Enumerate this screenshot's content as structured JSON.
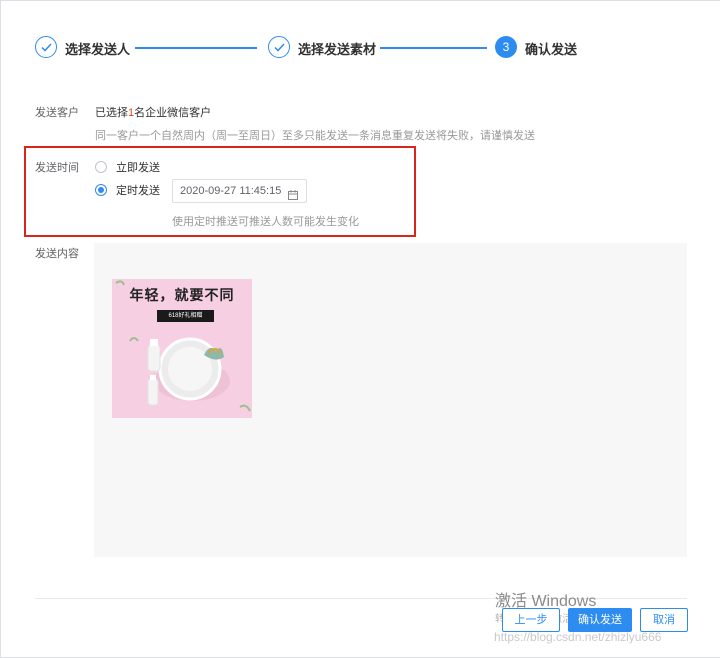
{
  "steps": [
    {
      "title": "选择发送人",
      "status": "done"
    },
    {
      "title": "选择发送素材",
      "status": "done"
    },
    {
      "title": "确认发送",
      "status": "active",
      "number": "3"
    }
  ],
  "recipients": {
    "label": "发送客户",
    "value_prefix": "已选择",
    "count": "1",
    "value_suffix": "名企业微信客户",
    "hint": "同一客户一个自然周内（周一至周日）至多只能发送一条消息重复发送将失败，请谨慎发送"
  },
  "send_time": {
    "label": "发送时间",
    "options": [
      {
        "label": "立即发送",
        "checked": false
      },
      {
        "label": "定时发送",
        "checked": true
      }
    ],
    "datetime_value": "2020-09-27 11:45:15",
    "hint": "使用定时推送可推送人数可能发生变化"
  },
  "content": {
    "label": "发送内容",
    "material_title": "年轻，就要不同",
    "material_tag": "618好礼相赠"
  },
  "buttons": {
    "prev": "上一步",
    "confirm": "确认发送",
    "cancel": "取消"
  },
  "os_overlay": {
    "activate_title": "激活 Windows",
    "activate_sub": "转到\"设置\"以激活 Windows。"
  },
  "watermark": "https://blog.csdn.net/zhizlyu666",
  "colors": {
    "primary": "#2d8cf0",
    "highlight_border": "#d9261c",
    "count": "#ed4014"
  }
}
